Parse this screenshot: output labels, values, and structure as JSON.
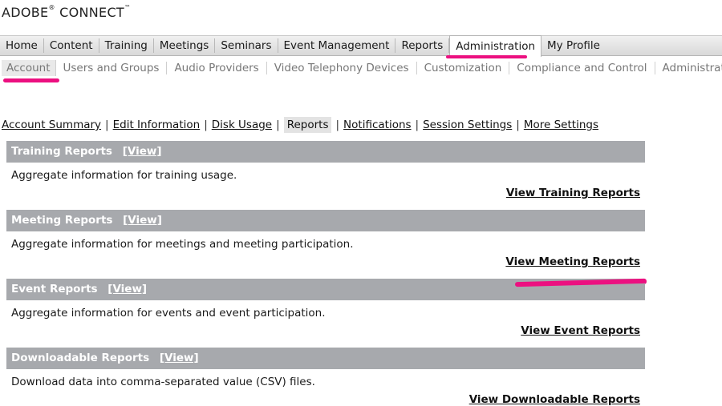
{
  "brand": {
    "name": "ADOBE",
    "registered": "®",
    "product": " CONNECT",
    "trademark": "™"
  },
  "main_nav": {
    "items": [
      "Home",
      "Content",
      "Training",
      "Meetings",
      "Seminars",
      "Event Management",
      "Reports",
      "Administration",
      "My Profile"
    ],
    "active": "Administration"
  },
  "sub_nav": {
    "items": [
      "Account",
      "Users and Groups",
      "Audio Providers",
      "Video Telephony Devices",
      "Customization",
      "Compliance and Control",
      "Administration"
    ],
    "active": "Account"
  },
  "account_tabs": {
    "items": [
      "Account Summary",
      "Edit Information",
      "Disk Usage",
      "Reports",
      "Notifications",
      "Session Settings",
      "More Settings"
    ],
    "separator": "|",
    "active": "Reports"
  },
  "sections": [
    {
      "title": "Training Reports",
      "view_label": "[View]",
      "description": "Aggregate information for training usage.",
      "link": "View Training Reports"
    },
    {
      "title": "Meeting Reports",
      "view_label": "[View]",
      "description": "Aggregate information for meetings and meeting participation.",
      "link": "View Meeting Reports"
    },
    {
      "title": "Event Reports",
      "view_label": "[View]",
      "description": "Aggregate information for events and event participation.",
      "link": "View Event Reports"
    },
    {
      "title": "Downloadable Reports",
      "view_label": "[View]",
      "description": "Download data into comma-separated value (CSV) files.",
      "link": "View Downloadable Reports"
    }
  ],
  "colors": {
    "highlight": "#ec1080",
    "section_bar": "#a7a9ad"
  }
}
